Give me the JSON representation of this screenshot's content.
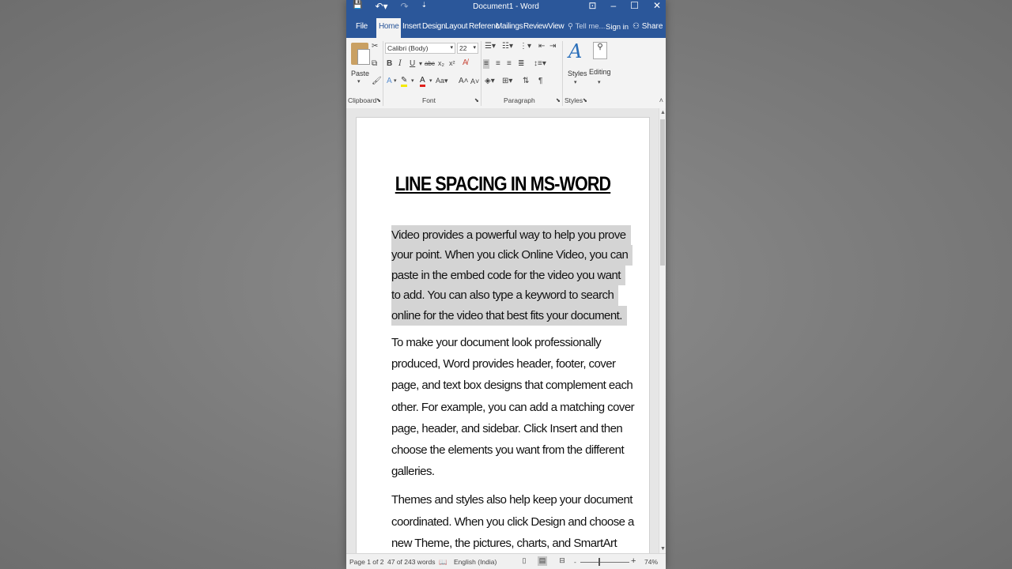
{
  "window": {
    "title": "Document1 - Word"
  },
  "qat": {
    "save": "💾",
    "undo": "↶▾",
    "redo": "↷",
    "customize": "⇣"
  },
  "tabs": {
    "file": "File",
    "home": "Home",
    "insert": "Insert",
    "design": "Design",
    "layout": "Layout",
    "references": "Referenc",
    "mailings": "Mailings",
    "review": "Review",
    "view": "View",
    "tellme": "Tell me...",
    "signin": "Sign in",
    "share": "Share"
  },
  "ribbon": {
    "paste_label": "Paste",
    "font_name": "Calibri (Body)",
    "font_size": "22",
    "styles_label": "Styles",
    "editing_label": "Editing",
    "groups": {
      "clipboard": "Clipboard",
      "font": "Font",
      "paragraph": "Paragraph",
      "styles": "Styles"
    }
  },
  "document": {
    "title": "LINE SPACING IN MS-WORD",
    "para1_lines": [
      "Video provides a powerful way to help you prove",
      "your point. When you click Online Video, you can",
      "paste in the embed code for the video you want",
      "to add. You can also type a keyword to search",
      "online for the video that best fits your document."
    ],
    "para2_lines": [
      "To make your document look professionally",
      "produced, Word provides header, footer, cover",
      "page, and text box designs that complement each",
      "other. For example, you can add a matching cover",
      "page, header, and sidebar. Click Insert and then",
      "choose the elements you want from the different",
      "galleries."
    ],
    "para3_lines": [
      "Themes and styles also help keep your document",
      "coordinated. When you click Design and choose a",
      "new Theme, the pictures, charts, and SmartArt"
    ]
  },
  "status": {
    "page": "Page 1 of 2",
    "words": "47 of 243 words",
    "language": "English (India)",
    "zoom": "74%"
  },
  "colors": {
    "accent": "#2b579a",
    "selection": "#d4d4d4"
  }
}
